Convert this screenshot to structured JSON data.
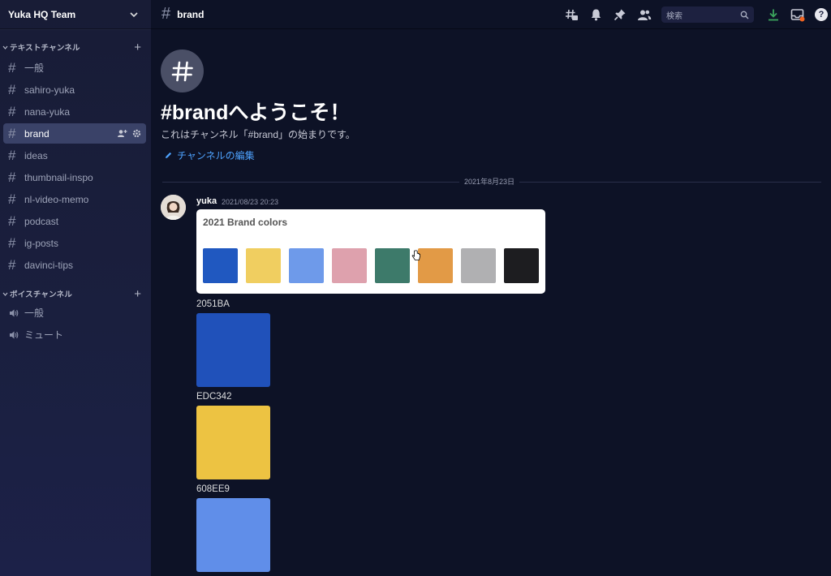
{
  "server": {
    "name": "Yuka HQ Team"
  },
  "sidebar": {
    "text_category": "テキストチャンネル",
    "text_channels": [
      {
        "label": "一般"
      },
      {
        "label": "sahiro-yuka"
      },
      {
        "label": "nana-yuka"
      },
      {
        "label": "brand",
        "active": true
      },
      {
        "label": "ideas"
      },
      {
        "label": "thumbnail-inspo"
      },
      {
        "label": "nl-video-memo"
      },
      {
        "label": "podcast"
      },
      {
        "label": "ig-posts"
      },
      {
        "label": "davinci-tips"
      }
    ],
    "voice_category": "ボイスチャンネル",
    "voice_channels": [
      {
        "label": "一般"
      },
      {
        "label": "ミュート"
      }
    ]
  },
  "header": {
    "channel_name": "brand",
    "search_placeholder": "検索"
  },
  "welcome": {
    "title": "#brandへようこそ！",
    "subtitle": "これはチャンネル「#brand」の始まりです。",
    "edit_link": "チャンネルの編集"
  },
  "divider_date": "2021年8月23日",
  "message": {
    "author": "yuka",
    "timestamp": "2021/08/23 20:23",
    "card_title": "2021 Brand colors",
    "swatches": [
      "#2058c0",
      "#f0ce60",
      "#6e9aea",
      "#dea1ad",
      "#3d7a6a",
      "#e29a46",
      "#b0b0b2",
      "#1d1d20"
    ],
    "colors": [
      {
        "code": "2051BA",
        "hex": "#2051BA"
      },
      {
        "code": "EDC342",
        "hex": "#EDC342"
      },
      {
        "code": "608EE9",
        "hex": "#608EE9"
      }
    ]
  },
  "icons": [
    "chevron-down-icon",
    "plus-icon",
    "hash-icon",
    "speaker-icon",
    "add-member-icon",
    "gear-icon",
    "threads-icon",
    "bell-icon",
    "pin-icon",
    "members-icon",
    "search-icon",
    "download-icon",
    "inbox-icon",
    "help-icon",
    "edit-icon"
  ]
}
